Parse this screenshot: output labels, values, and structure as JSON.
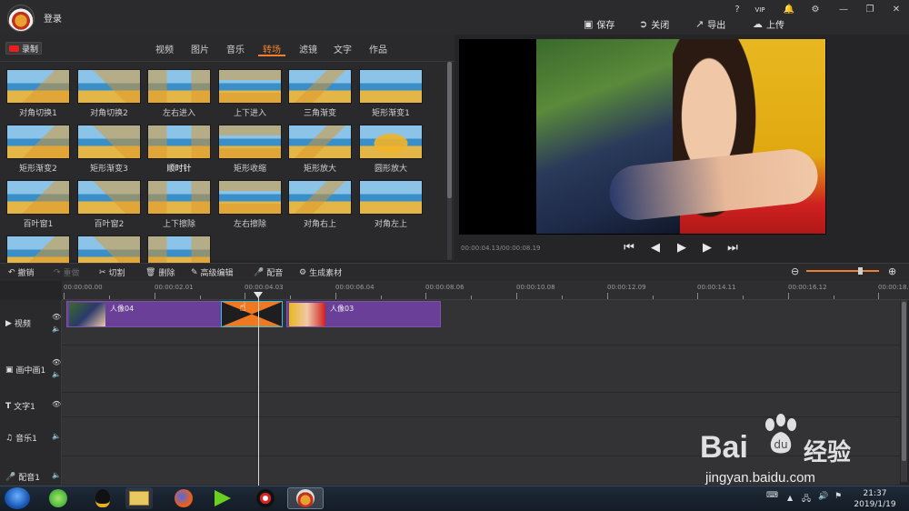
{
  "titlebar": {
    "login": "登录",
    "window_buttons": [
      "?",
      "VIP",
      "🔔",
      "⚙",
      "—",
      "❐",
      "✕"
    ],
    "actions": [
      {
        "label": "保存",
        "icon": "save-icon"
      },
      {
        "label": "关闭",
        "icon": "exit-icon"
      },
      {
        "label": "导出",
        "icon": "export-icon"
      },
      {
        "label": "上传",
        "icon": "upload-icon"
      }
    ]
  },
  "library": {
    "record_label": "录制",
    "tabs": [
      "视频",
      "图片",
      "音乐",
      "转场",
      "滤镜",
      "文字",
      "作品"
    ],
    "active_tab": "转场",
    "transitions": [
      "对角切换1",
      "对角切换2",
      "左右进入",
      "上下进入",
      "三角渐变",
      "矩形渐变1",
      "矩形渐变2",
      "矩形渐变3",
      "顺时针",
      "矩形收缩",
      "矩形放大",
      "圆形放大",
      "百叶窗1",
      "百叶窗2",
      "上下擦除",
      "左右擦除",
      "对角右上",
      "对角左上",
      "",
      "",
      ""
    ]
  },
  "preview": {
    "timecode": "00:00:04.13/00:00:08.19",
    "controls": [
      "skip-start",
      "step-back",
      "play",
      "step-forward",
      "skip-end"
    ]
  },
  "toolbar": {
    "items": [
      {
        "label": "撤销",
        "icon": "undo-icon",
        "enabled": true
      },
      {
        "label": "重做",
        "icon": "redo-icon",
        "enabled": false
      },
      {
        "label": "切割",
        "icon": "scissors-icon",
        "enabled": true
      },
      {
        "label": "删除",
        "icon": "trash-icon",
        "enabled": true
      },
      {
        "label": "高级编辑",
        "icon": "edit-icon",
        "enabled": true
      },
      {
        "label": "配音",
        "icon": "microphone-icon",
        "enabled": true
      },
      {
        "label": "生成素材",
        "icon": "gear-icon",
        "enabled": true
      }
    ],
    "zoom_level": 0.75
  },
  "timeline": {
    "ruler": [
      "00:00:00.00",
      "00:00:02.01",
      "00:00:04.03",
      "00:00:06.04",
      "00:00:08.06",
      "00:00:10.08",
      "00:00:12.09",
      "00:00:14.11",
      "00:00:16.12",
      "00:00:18.1"
    ],
    "tracks": [
      {
        "name": "视频",
        "icon": "video-icon"
      },
      {
        "name": "画中画1",
        "icon": "pip-icon"
      },
      {
        "name": "文字1",
        "icon": "text-icon"
      },
      {
        "name": "音乐1",
        "icon": "music-icon"
      },
      {
        "name": "配音1",
        "icon": "microphone-icon"
      }
    ],
    "clips": [
      {
        "label": "人像04"
      },
      {
        "label": "人像03"
      }
    ]
  },
  "taskbar": {
    "time": "21:37",
    "date": "2019/1/19"
  },
  "watermark": {
    "brand": "Bai",
    "brand2": "经验",
    "url": "jingyan.baidu.com"
  },
  "colors": {
    "accent": "#f08030",
    "clip": "#6a3f97",
    "transition": "#f07820"
  }
}
